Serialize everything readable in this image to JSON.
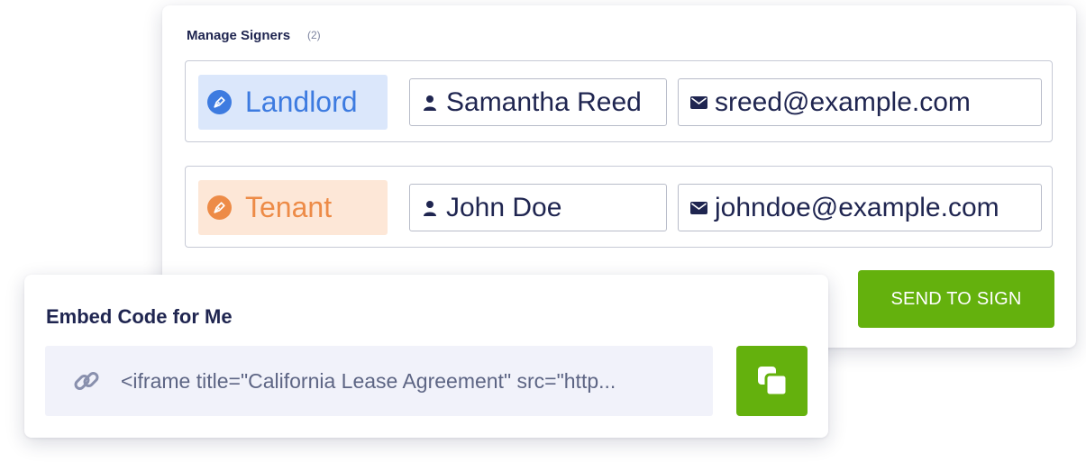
{
  "manage_signers": {
    "title": "Manage Signers",
    "count": "(2)",
    "signers": [
      {
        "role": "Landlord",
        "role_color": "#3d7be0",
        "role_bg": "#dbe7fb",
        "name": "Samantha Reed",
        "email": "sreed@example.com"
      },
      {
        "role": "Tenant",
        "role_color": "#ed8b47",
        "role_bg": "#fde7d7",
        "name": "John Doe",
        "email": "johndoe@example.com"
      }
    ],
    "send_button": "SEND TO SIGN"
  },
  "embed": {
    "title": "Embed Code for Me",
    "code": "<iframe title=\"California Lease Agreement\" src=\"http..."
  },
  "colors": {
    "accent_green": "#64b10d",
    "text_dark": "#1f2550"
  },
  "icons": {
    "role": "pen-nib-icon",
    "name": "user-icon",
    "email": "envelope-icon",
    "link": "link-icon",
    "copy": "copy-icon"
  }
}
